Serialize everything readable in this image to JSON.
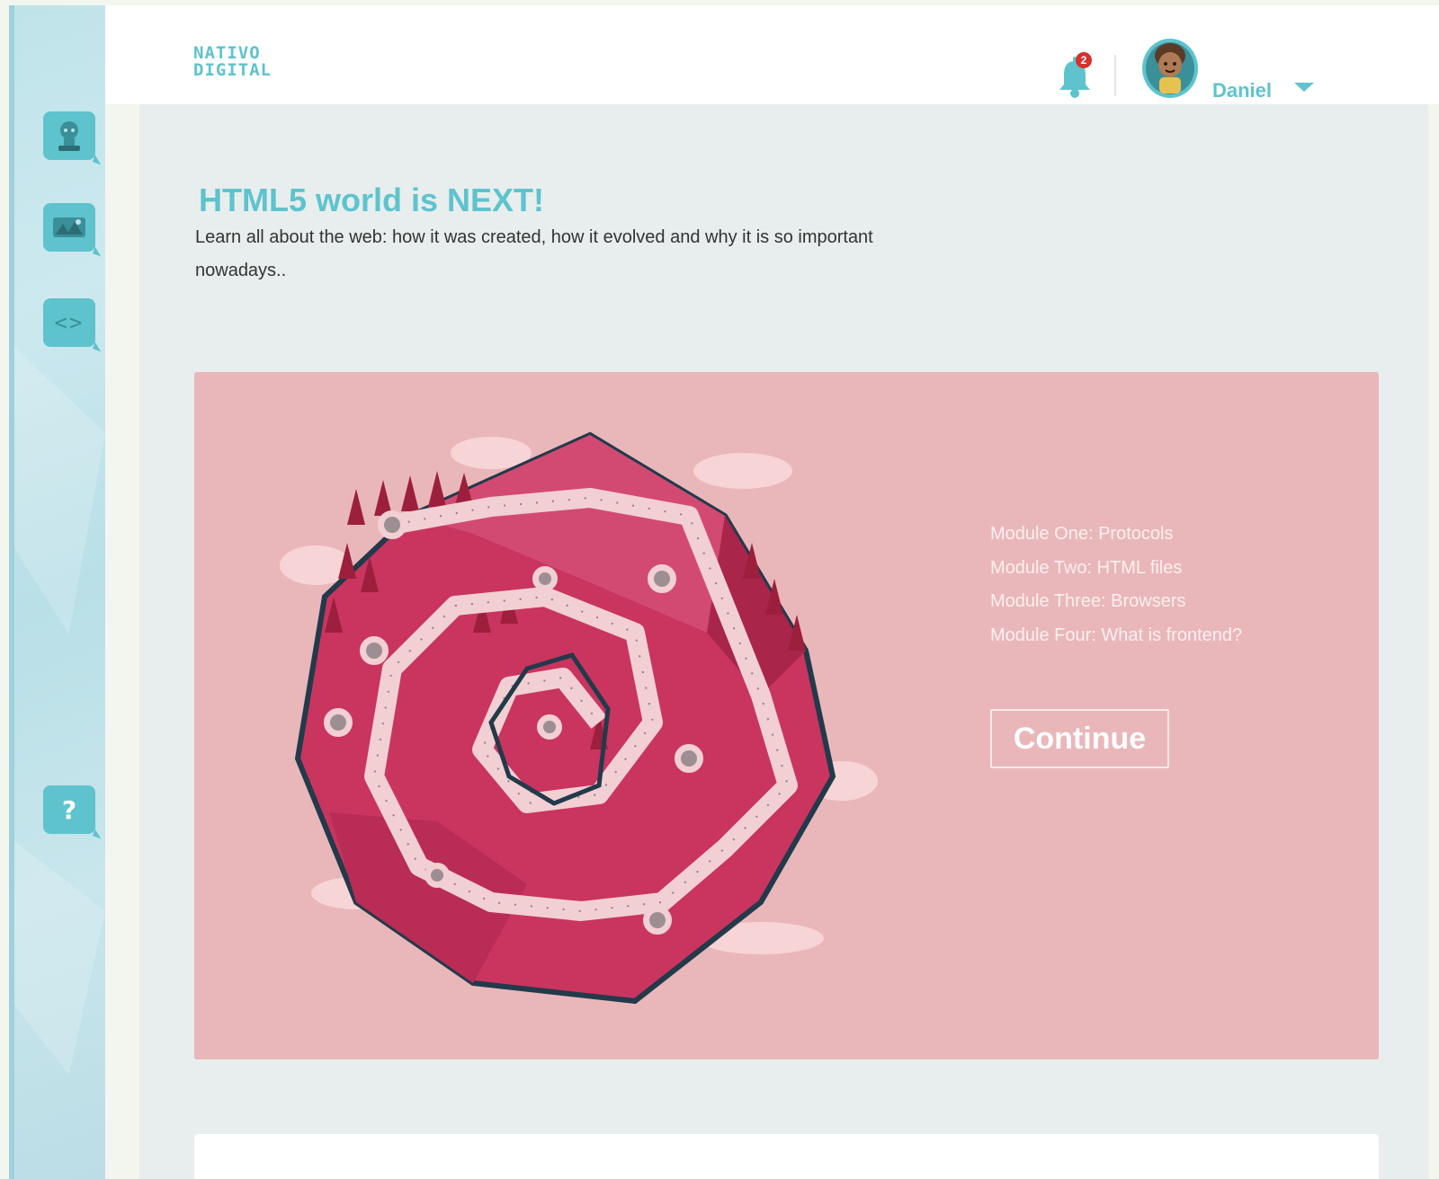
{
  "brand": {
    "logo_line1": "NATIVO",
    "logo_line2": "DIGITAL"
  },
  "header": {
    "notification_count": "2",
    "user_name": "Daniel"
  },
  "sidebar": {
    "items": [
      {
        "icon": "robot-avatar-icon"
      },
      {
        "icon": "landscape-icon"
      },
      {
        "icon": "code-icon",
        "label": "<>"
      },
      {
        "icon": "help-icon",
        "label": "?"
      }
    ]
  },
  "main": {
    "title": "HTML5 world is NEXT!",
    "description": "Learn all about the web: how it was created, how it evolved and why it is so important nowadays..",
    "modules": [
      "Module One: Protocols",
      "Module Two: HTML files",
      "Module Three: Browsers",
      "Module Four: What is frontend?"
    ],
    "continue_label": "Continue"
  },
  "colors": {
    "accent": "#5ec3cd",
    "card_background": "#e9b7ba",
    "island": "#c9355f",
    "badge": "#d8302b"
  }
}
